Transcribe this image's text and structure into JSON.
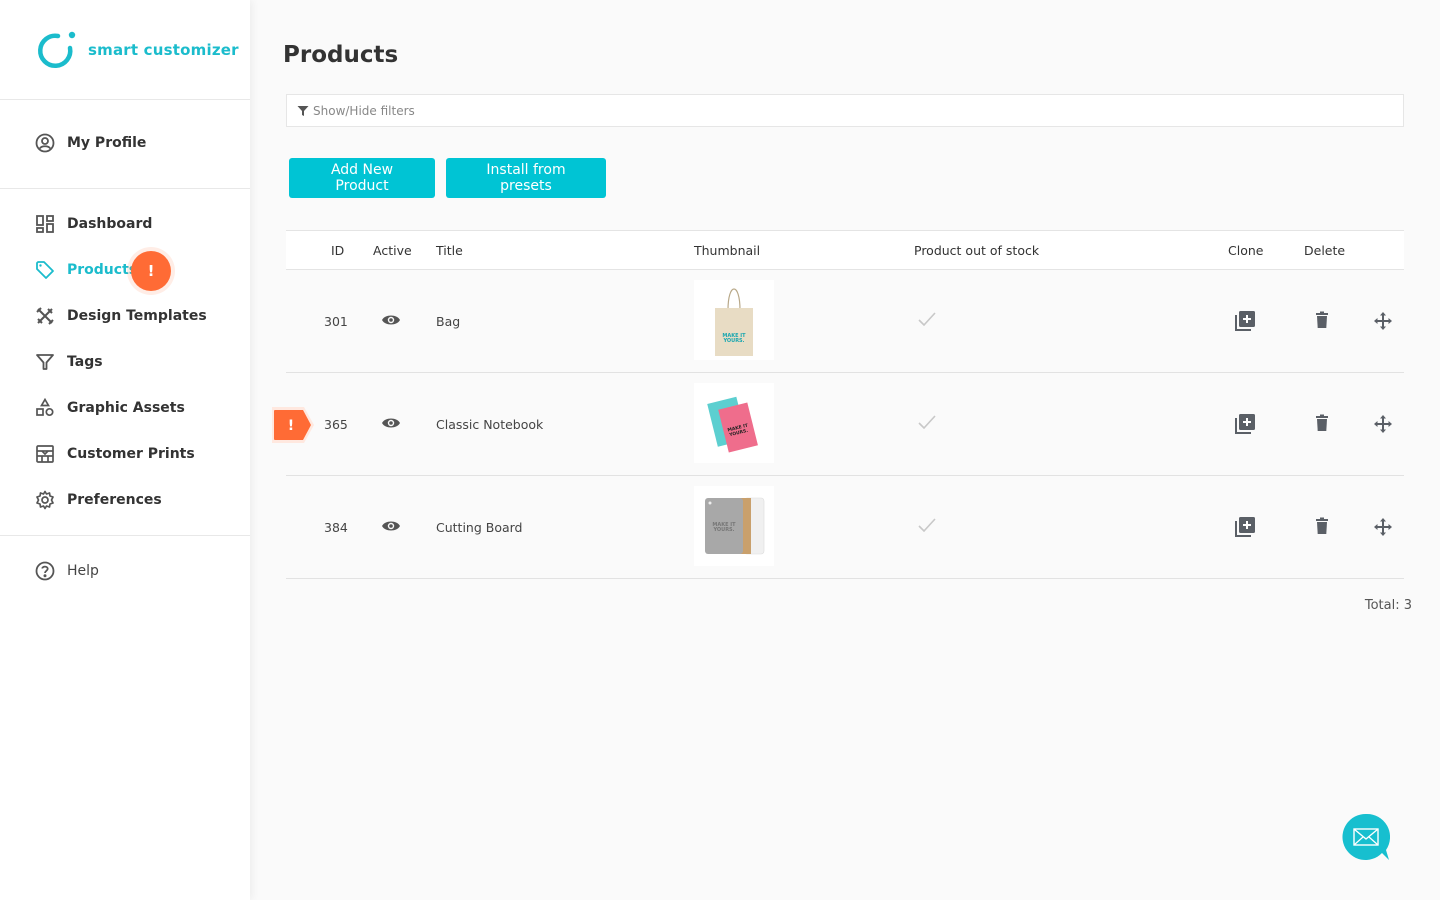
{
  "brand": {
    "name": "smart customizer",
    "accent": "#1bbccc",
    "button_color": "#00c4d4",
    "warning_color": "#ff6b35"
  },
  "sidebar": {
    "profile": {
      "label": "My Profile",
      "icon": "user-circle-icon"
    },
    "items": [
      {
        "label": "Dashboard",
        "icon": "dashboard-icon"
      },
      {
        "label": "Products",
        "icon": "tag-icon",
        "active": true,
        "badge": "!"
      },
      {
        "label": "Design Templates",
        "icon": "design-tools-icon"
      },
      {
        "label": "Tags",
        "icon": "filter-icon"
      },
      {
        "label": "Graphic Assets",
        "icon": "shapes-icon"
      },
      {
        "label": "Customer Prints",
        "icon": "prints-icon"
      },
      {
        "label": "Preferences",
        "icon": "gear-icon"
      }
    ],
    "help": {
      "label": "Help",
      "icon": "question-circle-icon"
    }
  },
  "main": {
    "title": "Products",
    "filter_toggle": "Show/Hide filters",
    "buttons": {
      "add": "Add New Product",
      "install": "Install from presets"
    },
    "table": {
      "headers": {
        "id": "ID",
        "active": "Active",
        "title": "Title",
        "thumbnail": "Thumbnail",
        "out_of_stock": "Product out of stock",
        "clone": "Clone",
        "delete": "Delete"
      },
      "rows": [
        {
          "id": "301",
          "active": true,
          "title": "Bag",
          "thumbnail": "tote-bag",
          "thumb_text": "MAKE IT YOURS.",
          "out_of_stock": false,
          "warning": false
        },
        {
          "id": "365",
          "active": true,
          "title": "Classic Notebook",
          "thumbnail": "notebooks",
          "thumb_text": "MAKE IT YOURS.",
          "out_of_stock": false,
          "warning": true,
          "warning_text": "!"
        },
        {
          "id": "384",
          "active": true,
          "title": "Cutting Board",
          "thumbnail": "cutting-board",
          "thumb_text": "MAKE IT YOURS.",
          "out_of_stock": false,
          "warning": false
        }
      ]
    },
    "total": "Total: 3"
  }
}
